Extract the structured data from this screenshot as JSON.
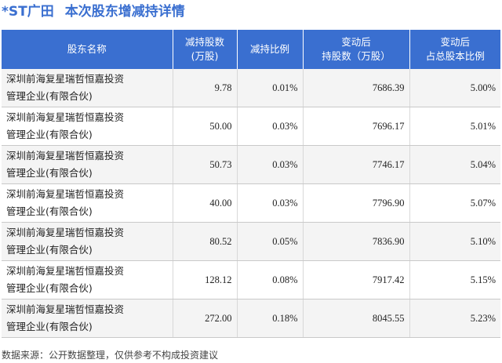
{
  "title": {
    "code": "*ST广田",
    "text": "本次股东增减持详情"
  },
  "table": {
    "headers": [
      [
        "股东名称"
      ],
      [
        "减持股数",
        "(万股)"
      ],
      [
        "减持比例"
      ],
      [
        "变动后",
        "持股数（万股）"
      ],
      [
        "变动后",
        "占总股本比例"
      ]
    ],
    "rows": [
      {
        "name1": "深圳前海复星瑞哲恒嘉投资",
        "name2": "管理企业(有限合伙)",
        "shares": "9.78",
        "ratio": "0.01%",
        "after_shares": "7686.39",
        "after_ratio": "5.00%"
      },
      {
        "name1": "深圳前海复星瑞哲恒嘉投资",
        "name2": "管理企业(有限合伙)",
        "shares": "50.00",
        "ratio": "0.03%",
        "after_shares": "7696.17",
        "after_ratio": "5.01%"
      },
      {
        "name1": "深圳前海复星瑞哲恒嘉投资",
        "name2": "管理企业(有限合伙)",
        "shares": "50.73",
        "ratio": "0.03%",
        "after_shares": "7746.17",
        "after_ratio": "5.04%"
      },
      {
        "name1": "深圳前海复星瑞哲恒嘉投资",
        "name2": "管理企业(有限合伙)",
        "shares": "40.00",
        "ratio": "0.03%",
        "after_shares": "7796.90",
        "after_ratio": "5.07%"
      },
      {
        "name1": "深圳前海复星瑞哲恒嘉投资",
        "name2": "管理企业(有限合伙)",
        "shares": "80.52",
        "ratio": "0.05%",
        "after_shares": "7836.90",
        "after_ratio": "5.10%"
      },
      {
        "name1": "深圳前海复星瑞哲恒嘉投资",
        "name2": "管理企业(有限合伙)",
        "shares": "128.12",
        "ratio": "0.08%",
        "after_shares": "7917.42",
        "after_ratio": "5.15%"
      },
      {
        "name1": "深圳前海复星瑞哲恒嘉投资",
        "name2": "管理企业(有限合伙)",
        "shares": "272.00",
        "ratio": "0.18%",
        "after_shares": "8045.55",
        "after_ratio": "5.23%"
      }
    ]
  },
  "source": "数据来源：公开数据整理，仅供参考不构成投资建议",
  "colors": {
    "header_bg": "#3a6fd0",
    "title": "#3a6fd0",
    "change_text": "#2e9a2e"
  }
}
